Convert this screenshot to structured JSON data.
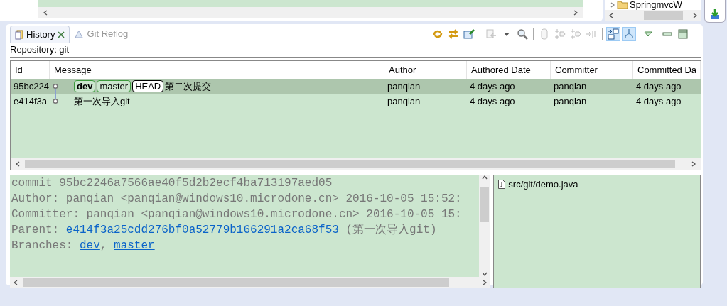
{
  "project_explorer": {
    "item": "SpringmvcW"
  },
  "tabs": [
    {
      "label": "History",
      "selected": true,
      "closable": true
    },
    {
      "label": "Git Reflog",
      "selected": false,
      "closable": false
    }
  ],
  "toolbar": [
    {
      "kind": "refresh",
      "pressed": false,
      "disabled": false
    },
    {
      "kind": "compare",
      "pressed": false,
      "disabled": false
    },
    {
      "kind": "pin",
      "pressed": false,
      "disabled": false
    },
    {
      "kind": "sep"
    },
    {
      "kind": "import",
      "pressed": false,
      "disabled": true
    },
    {
      "kind": "dropdown",
      "pressed": false,
      "disabled": false
    },
    {
      "kind": "search",
      "pressed": false,
      "disabled": false
    },
    {
      "kind": "sep"
    },
    {
      "kind": "cylinder",
      "pressed": false,
      "disabled": true
    },
    {
      "kind": "merge",
      "pressed": false,
      "disabled": true
    },
    {
      "kind": "merge",
      "pressed": false,
      "disabled": true
    },
    {
      "kind": "list",
      "pressed": false,
      "disabled": true
    },
    {
      "kind": "sep"
    },
    {
      "kind": "layout",
      "pressed": true,
      "disabled": false
    },
    {
      "kind": "branches",
      "pressed": true,
      "disabled": false
    },
    {
      "kind": "menu",
      "pressed": false,
      "disabled": false
    },
    {
      "kind": "minimize",
      "pressed": false,
      "disabled": false
    },
    {
      "kind": "maximize",
      "pressed": false,
      "disabled": false
    }
  ],
  "repository_label": "Repository: git",
  "table": {
    "columns": [
      "Id",
      "Message",
      "Author",
      "Authored Date",
      "Committer",
      "Committed Da"
    ],
    "rows": [
      {
        "selected": true,
        "id": "95bc224",
        "kind": "tip",
        "refs": [
          {
            "name": "dev",
            "kind": "current"
          },
          {
            "name": "master",
            "kind": "branch"
          },
          {
            "name": "HEAD",
            "kind": "head"
          }
        ],
        "message": "第二次提交",
        "author": "panqian",
        "authored_date": "4 days ago",
        "committer": "panqian",
        "committed_date": "4 days ago"
      },
      {
        "selected": false,
        "id": "e414f3a",
        "kind": "root",
        "refs": [],
        "message": "第一次导入git",
        "author": "panqian",
        "authored_date": "4 days ago",
        "committer": "panqian",
        "committed_date": "4 days ago"
      }
    ]
  },
  "details": {
    "lines": [
      [
        {
          "text": "commit 95bc2246a7566ae40f5d2b2ecf4ba713197aed05",
          "link": false
        }
      ],
      [
        {
          "text": "Author: panqian <panqian@windows10.microdone.cn> 2016-10-05 15:52:",
          "link": false
        }
      ],
      [
        {
          "text": "Committer: panqian <panqian@windows10.microdone.cn> 2016-10-05 15:",
          "link": false
        }
      ],
      [
        {
          "text": "Parent: ",
          "link": false
        },
        {
          "text": "e414f3a25cdd276bf0a52779b166291a2ca68f53",
          "link": true
        },
        {
          "text": " (第一次导入git)",
          "link": false
        }
      ],
      [
        {
          "text": "Branches: ",
          "link": false
        },
        {
          "text": "dev",
          "link": true
        },
        {
          "text": ", ",
          "link": false
        },
        {
          "text": "master",
          "link": true
        }
      ]
    ]
  },
  "files": [
    "src/git/demo.java"
  ]
}
